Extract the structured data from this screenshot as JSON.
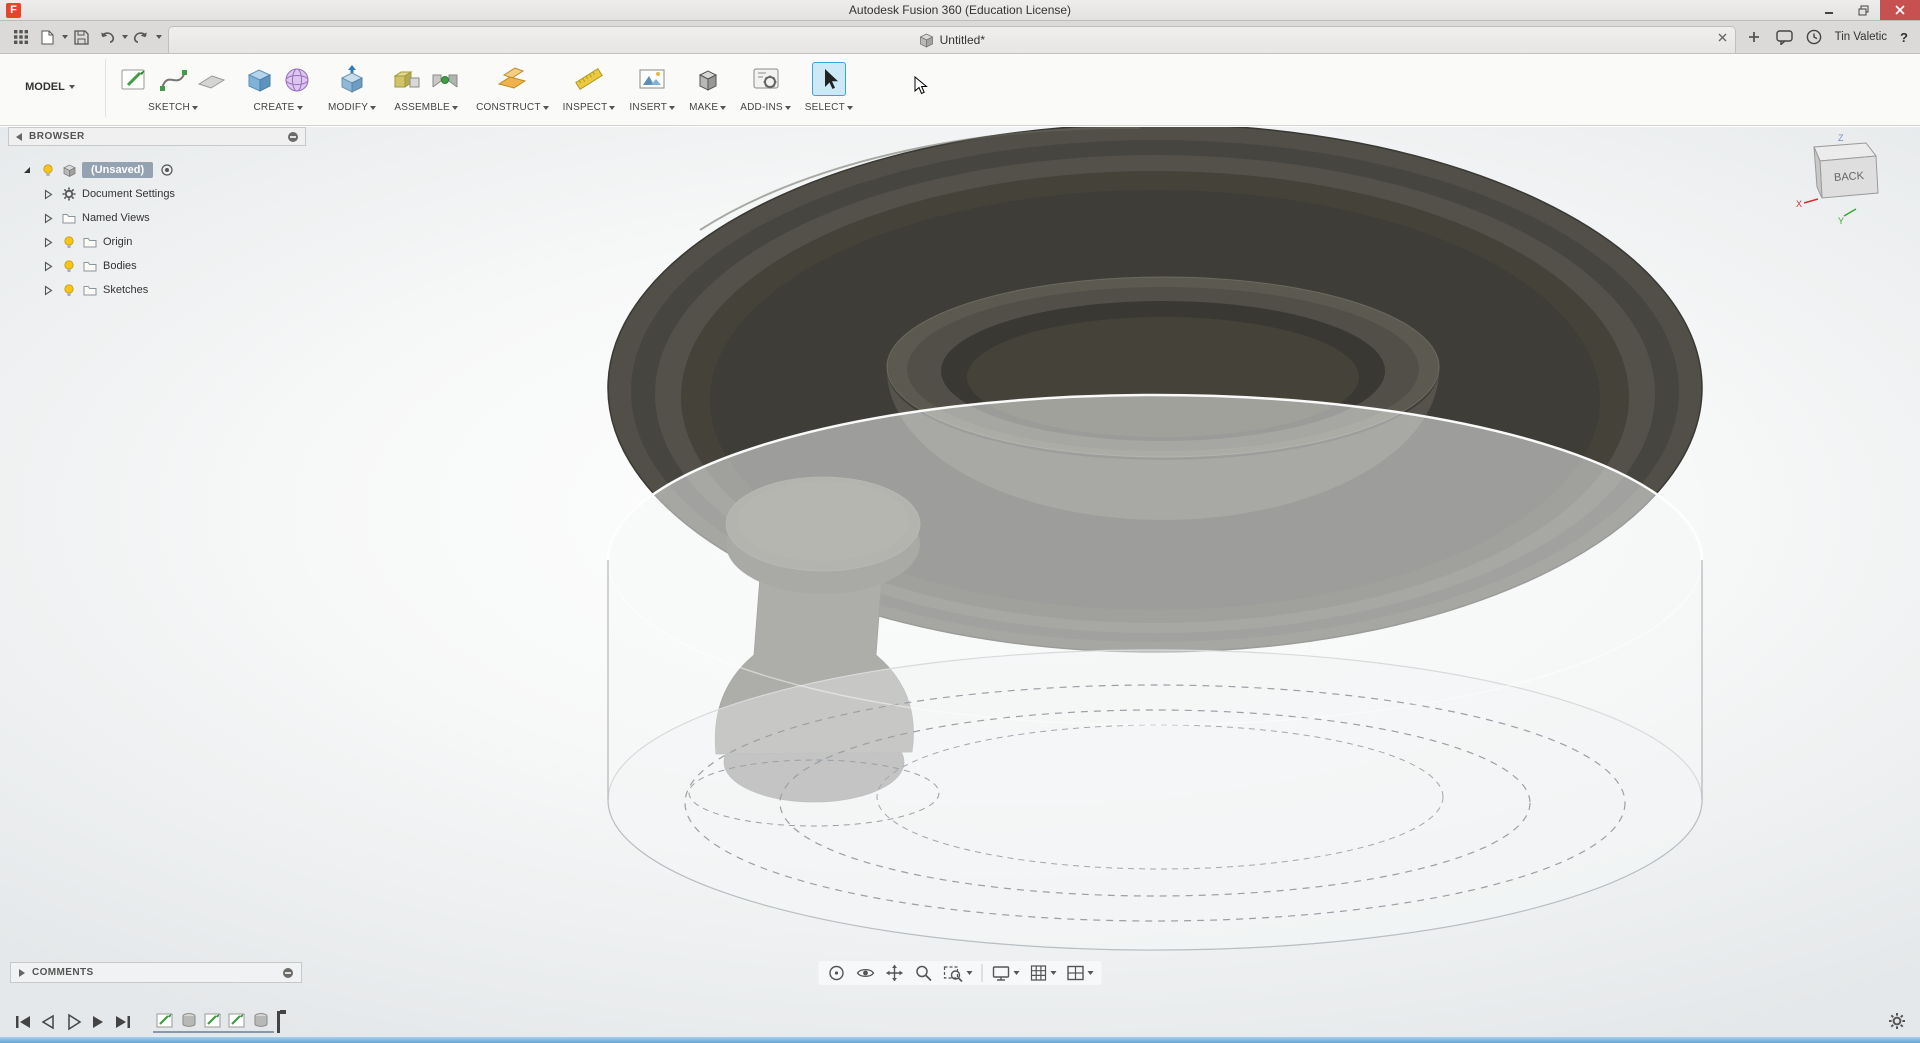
{
  "window": {
    "title": "Autodesk Fusion 360 (Education License)",
    "logo_letter": "F"
  },
  "tabs": {
    "document": "Untitled*",
    "user_name": "Tin Valetic"
  },
  "ribbon": {
    "workspace": "MODEL",
    "groups": [
      {
        "label": "SKETCH"
      },
      {
        "label": "CREATE"
      },
      {
        "label": "MODIFY"
      },
      {
        "label": "ASSEMBLE"
      },
      {
        "label": "CONSTRUCT"
      },
      {
        "label": "INSPECT"
      },
      {
        "label": "INSERT"
      },
      {
        "label": "MAKE"
      },
      {
        "label": "ADD-INS"
      },
      {
        "label": "SELECT"
      }
    ]
  },
  "browser": {
    "header": "BROWSER",
    "root": "(Unsaved)",
    "items": [
      {
        "label": "Document Settings",
        "icon": "gear"
      },
      {
        "label": "Named Views",
        "icon": "folder"
      },
      {
        "label": "Origin",
        "icon": "folder",
        "bulb": true
      },
      {
        "label": "Bodies",
        "icon": "folder",
        "bulb": true
      },
      {
        "label": "Sketches",
        "icon": "folder",
        "bulb": true
      }
    ]
  },
  "viewcube": {
    "face": "BACK",
    "axis_x": "X",
    "axis_y": "Y",
    "axis_z": "Z"
  },
  "comments": {
    "header": "COMMENTS"
  },
  "navbar": {
    "icons": [
      "orbit",
      "look-at",
      "pan",
      "zoom",
      "fit",
      "display-settings",
      "grid-settings",
      "viewports"
    ]
  },
  "timeline": {
    "controls": [
      "go-to-start",
      "step-back",
      "play",
      "step-forward",
      "go-to-end"
    ],
    "items": [
      "sketch",
      "feature",
      "sketch",
      "sketch",
      "feature"
    ]
  },
  "colors": {
    "accent_blue": "#3fa4dc",
    "close_red": "#c75050",
    "bulb_yellow": "#f2c12e",
    "model_dark": "#4f4e47",
    "taskbar_blue": "#66a5d5"
  }
}
